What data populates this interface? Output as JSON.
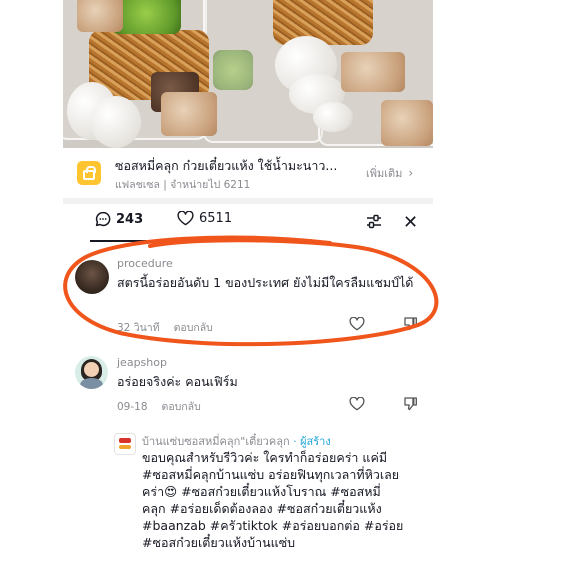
{
  "product": {
    "title": "ซอสหมี่คลุก ก๋วยเตี๋ยวแห้ง ใช้น้ำมะนาว...",
    "subtitle": "แฟลชเซล | จำหน่ายไป 6211",
    "more_label": "เพิ่มเติม",
    "bag_icon": "shopping-bag-icon",
    "bag_color": "#ffc531"
  },
  "stats": {
    "comments_count": "243",
    "likes_count": "6511",
    "comment_icon": "comment-bubble-icon",
    "like_icon": "heart-outline-icon",
    "filter_icon": "filter-sliders-icon",
    "close_icon": "close-icon",
    "close_glyph": "✕"
  },
  "comments": [
    {
      "username": "procedure",
      "text": "สตรนี้อร่อยอันดับ 1 ของประเทศ ยังไม่มีใครลืมแชมป์ได้",
      "time": "32 วินาที",
      "reply_label": "ตอบกลับ"
    },
    {
      "username": "jeapshop",
      "text": "อร่อยจริงค่ะ คอนเฟิร์ม",
      "time": "09-18",
      "reply_label": "ตอบกลับ"
    },
    {
      "username": "บ้านแซ่บซอสหมี่คลุก\"เตี๋ยวคลุก",
      "creator_badge": "· ผู้สร้าง",
      "text_lines": [
        "ขอบคุณสำหรับรีวิวค่ะ ใครทำก็อร่อยคร่า แค่มี",
        "#ซอสหมี่คลุกบ้านแซ่บ อร่อยฟินทุกเวลาที่หิวเลย",
        "คร่า😍 #ซอสก๋วยเตี๋ยวแห้งโบราณ #ซอสหมี่",
        "คลุก #อร่อยเด็ดต้องลอง #ซอสก๋วยเตี๋ยวแห้ง",
        "#baanzab #ครัวtiktok #อร่อยบอกต่อ #อร่อย",
        "#ซอสก๋วยเตี๋ยวแห้งบ้านแซ่บ"
      ]
    }
  ],
  "colors": {
    "annotation_circle": "#f0561c",
    "muted_text": "#8a8b91",
    "creator_badge": "#25a6d9"
  }
}
